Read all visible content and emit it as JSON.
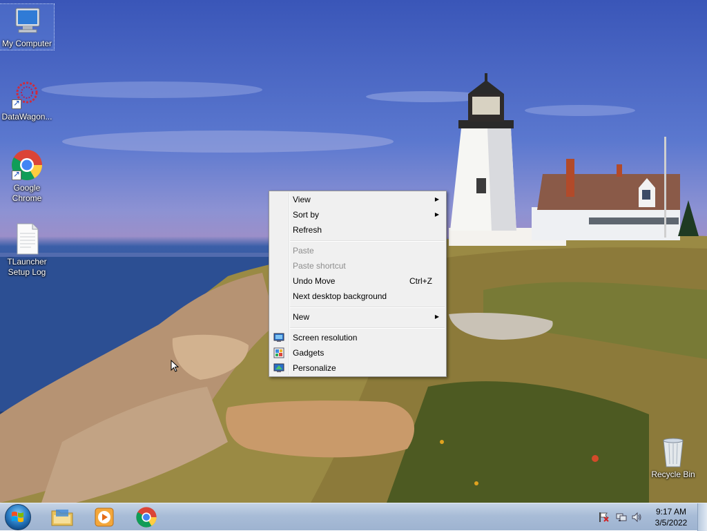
{
  "desktop_icons": [
    {
      "name": "My Computer",
      "icon": "computer-icon",
      "selected": true
    },
    {
      "name": "DataWagon...",
      "icon": "datawagon-icon",
      "shortcut": true
    },
    {
      "name": "Google Chrome",
      "line1": "Google",
      "line2": "Chrome",
      "icon": "chrome-icon",
      "shortcut": true
    },
    {
      "name": "TLauncher Setup Log",
      "line1": "TLauncher",
      "line2": "Setup Log",
      "icon": "text-file-icon"
    },
    {
      "name": "Recycle Bin",
      "icon": "recycle-bin-icon"
    }
  ],
  "context_menu": {
    "items": [
      {
        "label": "View",
        "submenu": true
      },
      {
        "label": "Sort by",
        "submenu": true
      },
      {
        "label": "Refresh"
      },
      {
        "label": "Paste",
        "disabled": true
      },
      {
        "label": "Paste shortcut",
        "disabled": true
      },
      {
        "label": "Undo Move",
        "shortcut": "Ctrl+Z"
      },
      {
        "label": "Next desktop background"
      },
      {
        "label": "New",
        "submenu": true
      },
      {
        "label": "Screen resolution",
        "icon": "screen-resolution-icon"
      },
      {
        "label": "Gadgets",
        "icon": "gadgets-icon"
      },
      {
        "label": "Personalize",
        "icon": "personalize-icon"
      }
    ]
  },
  "taskbar": {
    "pinned": [
      {
        "name": "Windows Explorer",
        "icon": "folder-icon"
      },
      {
        "name": "Windows Media Player",
        "icon": "media-player-icon"
      },
      {
        "name": "Google Chrome",
        "icon": "chrome-icon"
      }
    ],
    "tray_icons": [
      "action-center-flag-icon",
      "network-icon",
      "volume-icon"
    ],
    "clock": {
      "time": "9:17 AM",
      "date": "3/5/2022"
    }
  },
  "colors": {
    "menu_bg": "#f0f0f0",
    "taskbar": "#a8bcd7",
    "sky": "#3a56b8"
  }
}
